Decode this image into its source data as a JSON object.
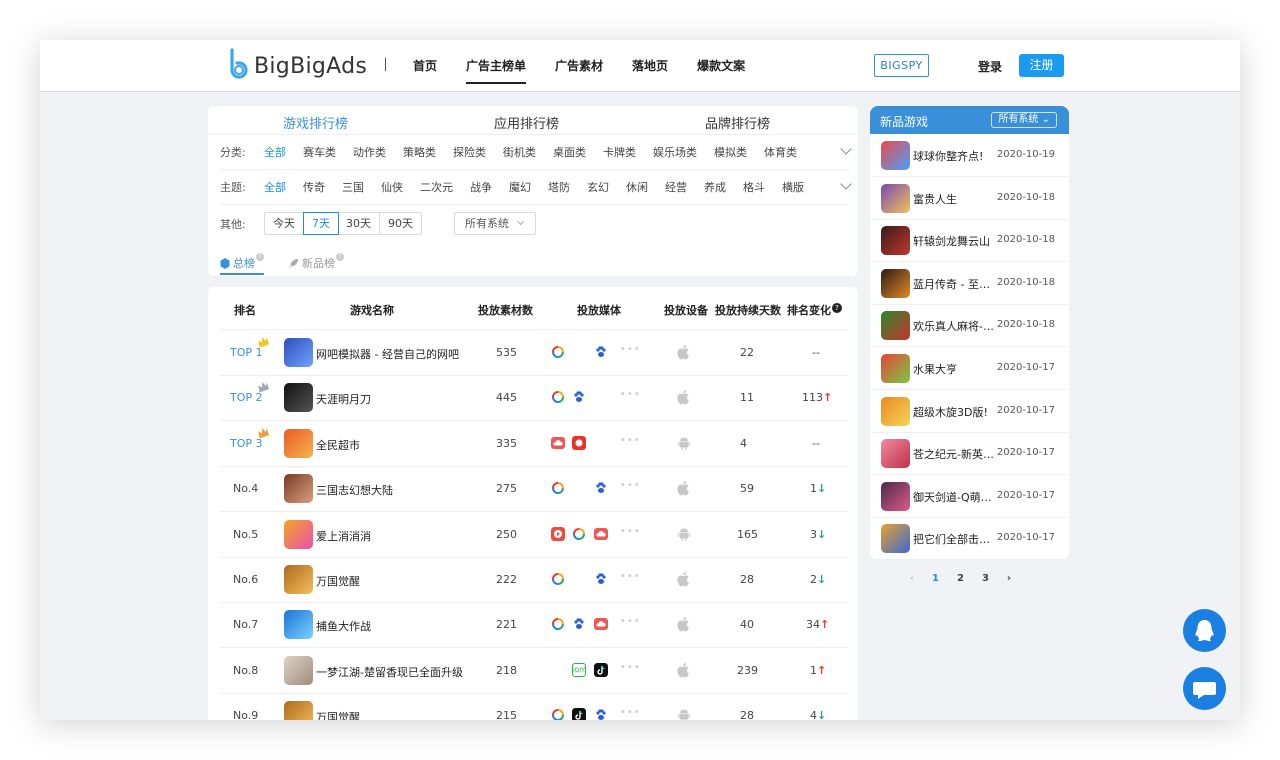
{
  "header": {
    "logo_text": "BigBigAds",
    "nav": [
      "首页",
      "广告主榜单",
      "广告素材",
      "落地页",
      "爆款文案"
    ],
    "nav_active": 1,
    "bigspy": "BIGSPY",
    "login": "登录",
    "register": "注册"
  },
  "main_tabs": [
    "游戏排行榜",
    "应用排行榜",
    "品牌排行榜"
  ],
  "filters": {
    "category_label": "分类:",
    "categories": [
      "全部",
      "赛车类",
      "动作类",
      "策略类",
      "探险类",
      "街机类",
      "桌面类",
      "卡牌类",
      "娱乐场类",
      "模拟类",
      "体育类"
    ],
    "theme_label": "主题:",
    "themes": [
      "全部",
      "传奇",
      "三国",
      "仙侠",
      "二次元",
      "战争",
      "魔幻",
      "塔防",
      "玄幻",
      "休闲",
      "经营",
      "养成",
      "格斗",
      "横版"
    ],
    "other_label": "其他:",
    "periods": [
      "今天",
      "7天",
      "30天",
      "90天"
    ],
    "period_active": 1,
    "system_select": "所有系统"
  },
  "subtabs": [
    "总榜",
    "新品榜"
  ],
  "table": {
    "headers": [
      "排名",
      "游戏名称",
      "投放素材数",
      "投放媒体",
      "投放设备",
      "投放持续天数",
      "排名变化"
    ],
    "rows": [
      {
        "rank": "TOP 1",
        "name": "网吧模拟器 - 经营自己的网吧",
        "materials": "535",
        "days": "22",
        "change": "--",
        "trend": ""
      },
      {
        "rank": "TOP 2",
        "name": "天涯明月刀",
        "materials": "445",
        "days": "11",
        "change": "113",
        "trend": "↑"
      },
      {
        "rank": "TOP 3",
        "name": "全民超市",
        "materials": "335",
        "days": "4",
        "change": "--",
        "trend": ""
      },
      {
        "rank": "No.4",
        "name": "三国志幻想大陆",
        "materials": "275",
        "days": "59",
        "change": "1",
        "trend": "↓"
      },
      {
        "rank": "No.5",
        "name": "爱上消消消",
        "materials": "250",
        "days": "165",
        "change": "3",
        "trend": "↓"
      },
      {
        "rank": "No.6",
        "name": "万国觉醒",
        "materials": "222",
        "days": "28",
        "change": "2",
        "trend": "↓"
      },
      {
        "rank": "No.7",
        "name": "捕鱼大作战",
        "materials": "221",
        "days": "40",
        "change": "34",
        "trend": "↑"
      },
      {
        "rank": "No.8",
        "name": "一梦江湖-楚留香现已全面升级",
        "materials": "218",
        "days": "239",
        "change": "1",
        "trend": "↑"
      },
      {
        "rank": "No.9",
        "name": "万国觉醒",
        "materials": "215",
        "days": "28",
        "change": "4",
        "trend": "↓"
      }
    ],
    "media_labels": {
      "toutiao": "头条",
      "iqiyi": "iQIY"
    }
  },
  "new_games": {
    "title": "新品游戏",
    "system_select": "所有系统",
    "items": [
      {
        "name": "球球你整齐点!",
        "date": "2020-10-19"
      },
      {
        "name": "富贵人生",
        "date": "2020-10-18"
      },
      {
        "name": "轩辕剑龙舞云山",
        "date": "2020-10-18"
      },
      {
        "name": "蓝月传奇 - 至尊...",
        "date": "2020-10-18"
      },
      {
        "name": "欢乐真人麻将-大...",
        "date": "2020-10-18"
      },
      {
        "name": "水果大亨",
        "date": "2020-10-17"
      },
      {
        "name": "超级木旋3D版!",
        "date": "2020-10-17"
      },
      {
        "name": "苍之纪元-新英雄...",
        "date": "2020-10-17"
      },
      {
        "name": "御天剑道-Q萌回...",
        "date": "2020-10-17"
      },
      {
        "name": "把它们全部击倒...",
        "date": "2020-10-17"
      }
    ],
    "pages": [
      "‹",
      "1",
      "2",
      "3",
      "›"
    ],
    "page_active": 1
  },
  "colors": {
    "accent": "#3a8fd9",
    "register": "#1a9bf0",
    "up": "#e53935",
    "down": "#2aa37a"
  }
}
